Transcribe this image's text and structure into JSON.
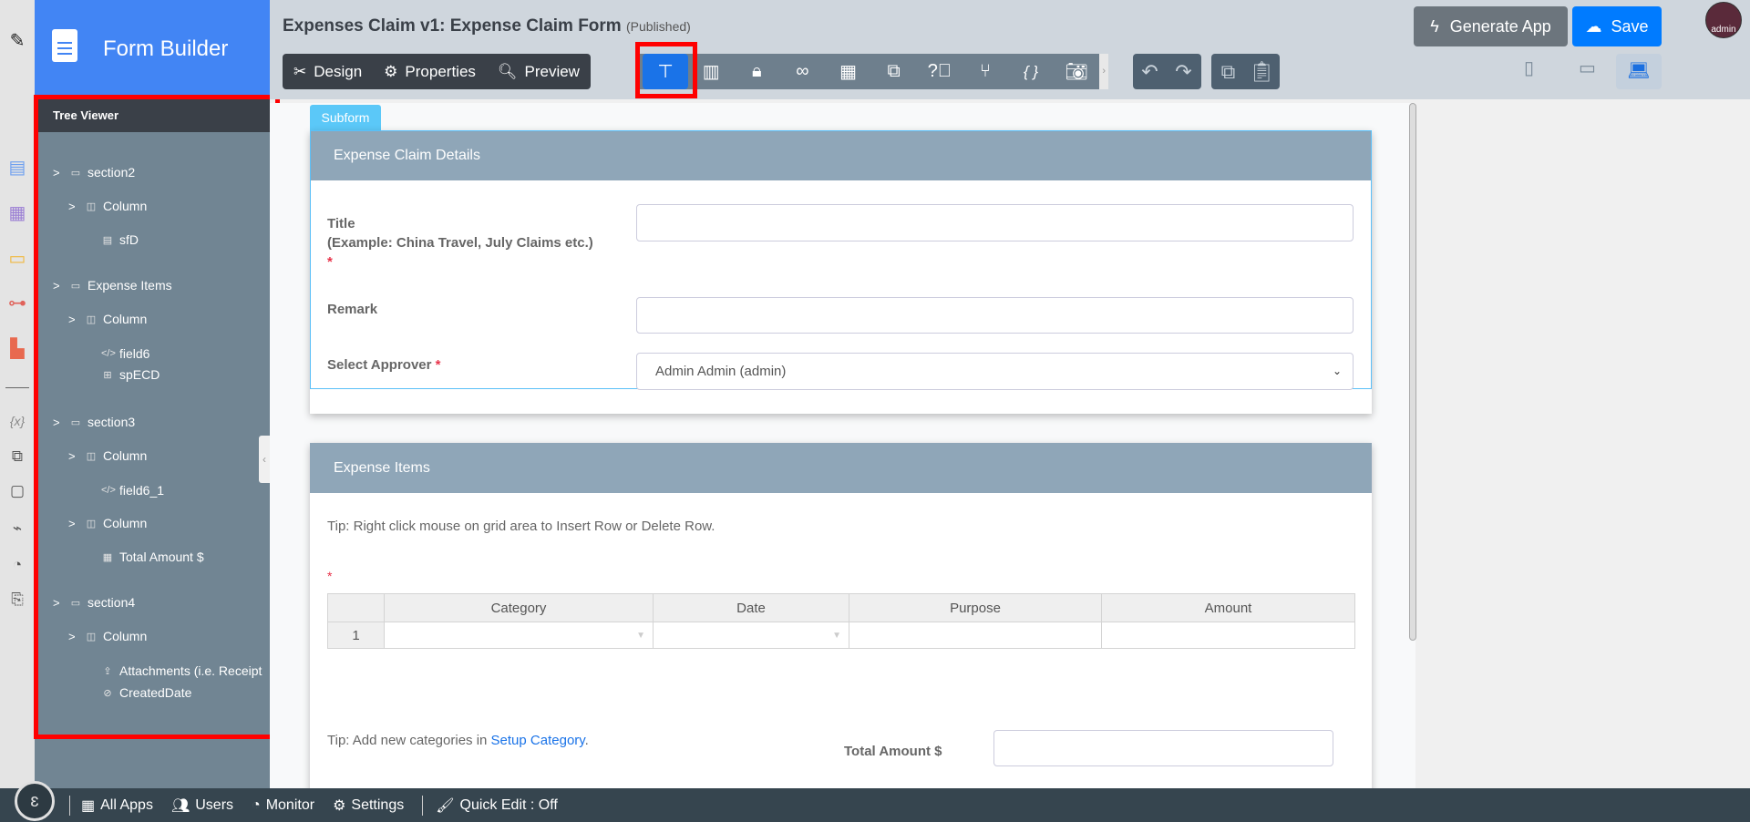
{
  "app": {
    "title": "Form Builder"
  },
  "header": {
    "form_title": "Expenses Claim v1: Expense Claim Form",
    "status": "(Published)",
    "generate_label": "Generate App",
    "save_label": "Save",
    "avatar_label": "admin"
  },
  "toolbar": {
    "design": "Design",
    "properties": "Properties",
    "preview": "Preview",
    "json_icon": "{ }"
  },
  "tree": {
    "title": "Tree Viewer",
    "items": [
      {
        "label": "section2",
        "icon": "section"
      },
      {
        "label": "Column",
        "icon": "column"
      },
      {
        "label": "sfD",
        "icon": "file"
      },
      {
        "label": "Expense Items",
        "icon": "section"
      },
      {
        "label": "Column",
        "icon": "column"
      },
      {
        "label": "field6",
        "icon": "code"
      },
      {
        "label": "spECD",
        "icon": "grid"
      },
      {
        "label": "section3",
        "icon": "section"
      },
      {
        "label": "Column",
        "icon": "column"
      },
      {
        "label": "field6_1",
        "icon": "code"
      },
      {
        "label": "Column",
        "icon": "column"
      },
      {
        "label": "Total Amount $",
        "icon": "calculator"
      },
      {
        "label": "section4",
        "icon": "section"
      },
      {
        "label": "Column",
        "icon": "column"
      },
      {
        "label": "Attachments (i.e. Receipt",
        "icon": "upload"
      },
      {
        "label": "CreatedDate",
        "icon": "eye-slash"
      }
    ]
  },
  "rail": {
    "variables": "{x}"
  },
  "form": {
    "subform_tab": "Subform",
    "section1": {
      "title": "Expense Claim Details",
      "title_label": "Title",
      "title_hint": "(Example: China Travel, July Claims etc.)",
      "remark_label": "Remark",
      "approver_label": "Select Approver",
      "approver_value": "Admin Admin (admin)",
      "required": "*"
    },
    "section2": {
      "title": "Expense Items",
      "tip": "Tip: Right click mouse on grid area to Insert Row or Delete Row.",
      "required": "*",
      "columns": [
        "Category",
        "Date",
        "Purpose",
        "Amount"
      ],
      "rows": [
        {
          "num": "1"
        }
      ],
      "tip2_prefix": "Tip: Add new categories in ",
      "tip2_link": "Setup Category",
      "tip2_suffix": ".",
      "total_label": "Total Amount $"
    }
  },
  "bottom": {
    "all_apps": "All Apps",
    "users": "Users",
    "monitor": "Monitor",
    "settings": "Settings",
    "quick_edit": "Quick Edit : Off"
  },
  "colors": {
    "brand": "#4285f4",
    "save": "#007bff",
    "highlight": "#ff0000"
  }
}
